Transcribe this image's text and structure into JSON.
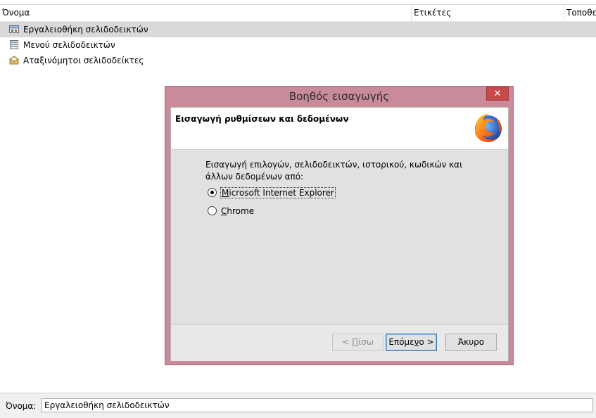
{
  "columns": {
    "name": "Όνομα",
    "tags": "Ετικέτες",
    "location": "Τοποθε"
  },
  "tree": {
    "items": [
      {
        "label": "Εργαλειοθήκη σελιδοδεικτών",
        "icon": "bookmarks-toolbar-icon",
        "selected": true
      },
      {
        "label": "Μενού σελιδοδεικτών",
        "icon": "bookmarks-menu-icon",
        "selected": false
      },
      {
        "label": "Αταξινόμητοι σελιδοδείκτες",
        "icon": "unsorted-bookmarks-icon",
        "selected": false
      }
    ]
  },
  "bottom": {
    "label": "Όνομα:",
    "value": "Εργαλειοθήκη σελιδοδεικτών"
  },
  "dialog": {
    "title": "Βοηθός εισαγωγής",
    "close_glyph": "✕",
    "heading": "Εισαγωγή ρυθμίσεων και δεδομένων",
    "description": "Εισαγωγή επιλογών, σελιδοδεικτών, ιστορικού, κωδικών και άλλων δεδομένων από:",
    "options": [
      {
        "pre": "",
        "mnemonic": "M",
        "post": "icrosoft Internet Explorer",
        "checked": true
      },
      {
        "pre": "",
        "mnemonic": "C",
        "post": "hrome",
        "checked": false
      }
    ],
    "buttons": {
      "back": {
        "pre": "< ",
        "mnemonic": "Π",
        "post": "ίσω"
      },
      "next": {
        "pre": "Επόμε",
        "mnemonic": "ν",
        "post": "ο >"
      },
      "cancel": "Άκυρο"
    }
  },
  "colors": {
    "selection": "#d9d9d9",
    "dialog_frame": "#c98b9a",
    "close_button": "#c74a4a",
    "default_button_border": "#3c7fb1"
  }
}
